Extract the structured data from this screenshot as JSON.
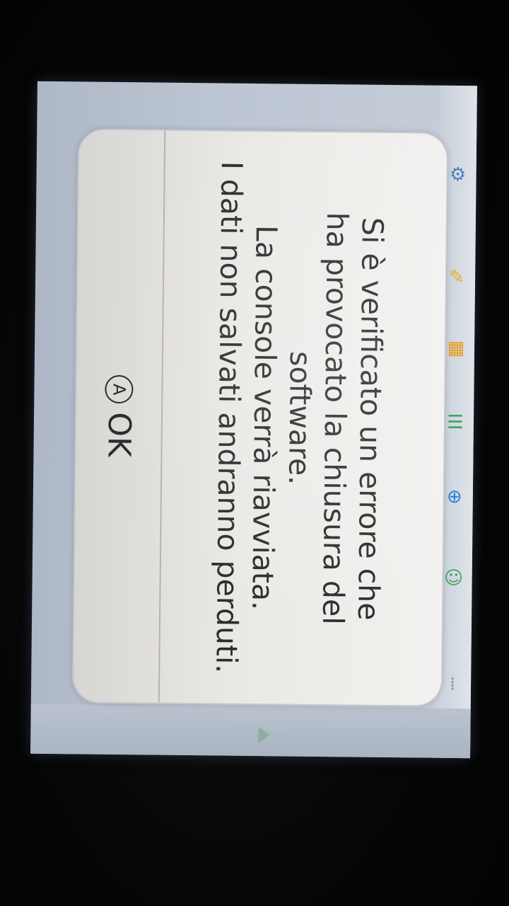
{
  "dialog": {
    "message_lines": [
      "Si è verificato un errore che",
      "ha provocato la chiusura del",
      "software.",
      "La console verrà riavviata.",
      "I dati non salvati andranno perduti."
    ],
    "button": {
      "icon": "a-button-icon",
      "icon_glyph": "A",
      "label": "OK"
    }
  },
  "side_menu": {
    "icons": [
      {
        "name": "settings-icon",
        "glyph": "⚙",
        "color": "#4d7fb8"
      },
      {
        "name": "notes-icon",
        "glyph": "✎",
        "color": "#e6b022"
      },
      {
        "name": "calendar-icon",
        "glyph": "▦",
        "color": "#e69a22"
      },
      {
        "name": "list-icon",
        "glyph": "☰",
        "color": "#3aa35a"
      },
      {
        "name": "globe-icon",
        "glyph": "⊕",
        "color": "#2d7fd0"
      },
      {
        "name": "friends-icon",
        "glyph": "☺",
        "color": "#42a65a"
      },
      {
        "name": "grid-icon",
        "glyph": "⁞",
        "color": "#8a94a3"
      }
    ]
  },
  "colors": {
    "dialog_bg": "#eeedeb",
    "text": "#2c2c2c",
    "screen_bg": "#bcc5d2"
  }
}
